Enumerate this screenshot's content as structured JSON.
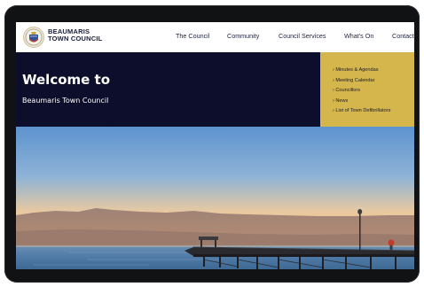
{
  "header": {
    "brand_line1": "BEAUMARIS",
    "brand_line2": "TOWN COUNCIL",
    "logo_icon": "council-crest-icon"
  },
  "nav": {
    "items": [
      {
        "label": "The Council"
      },
      {
        "label": "Community"
      },
      {
        "label": "Council Services"
      },
      {
        "label": "What's On"
      },
      {
        "label": "Contact"
      }
    ]
  },
  "hero": {
    "title": "Welcome to",
    "subtitle": "Beaumaris Town Council"
  },
  "quick_links": {
    "arrow_icon": "chevron-right-icon",
    "items": [
      {
        "label": "Minutes & Agendas"
      },
      {
        "label": "Meeting Calendar"
      },
      {
        "label": "Councillors"
      },
      {
        "label": "News"
      },
      {
        "label": "List of Town Defibrillators"
      }
    ]
  },
  "colors": {
    "navy": "#0d0e2b",
    "gold": "#d5b64c",
    "device": "#111214"
  }
}
